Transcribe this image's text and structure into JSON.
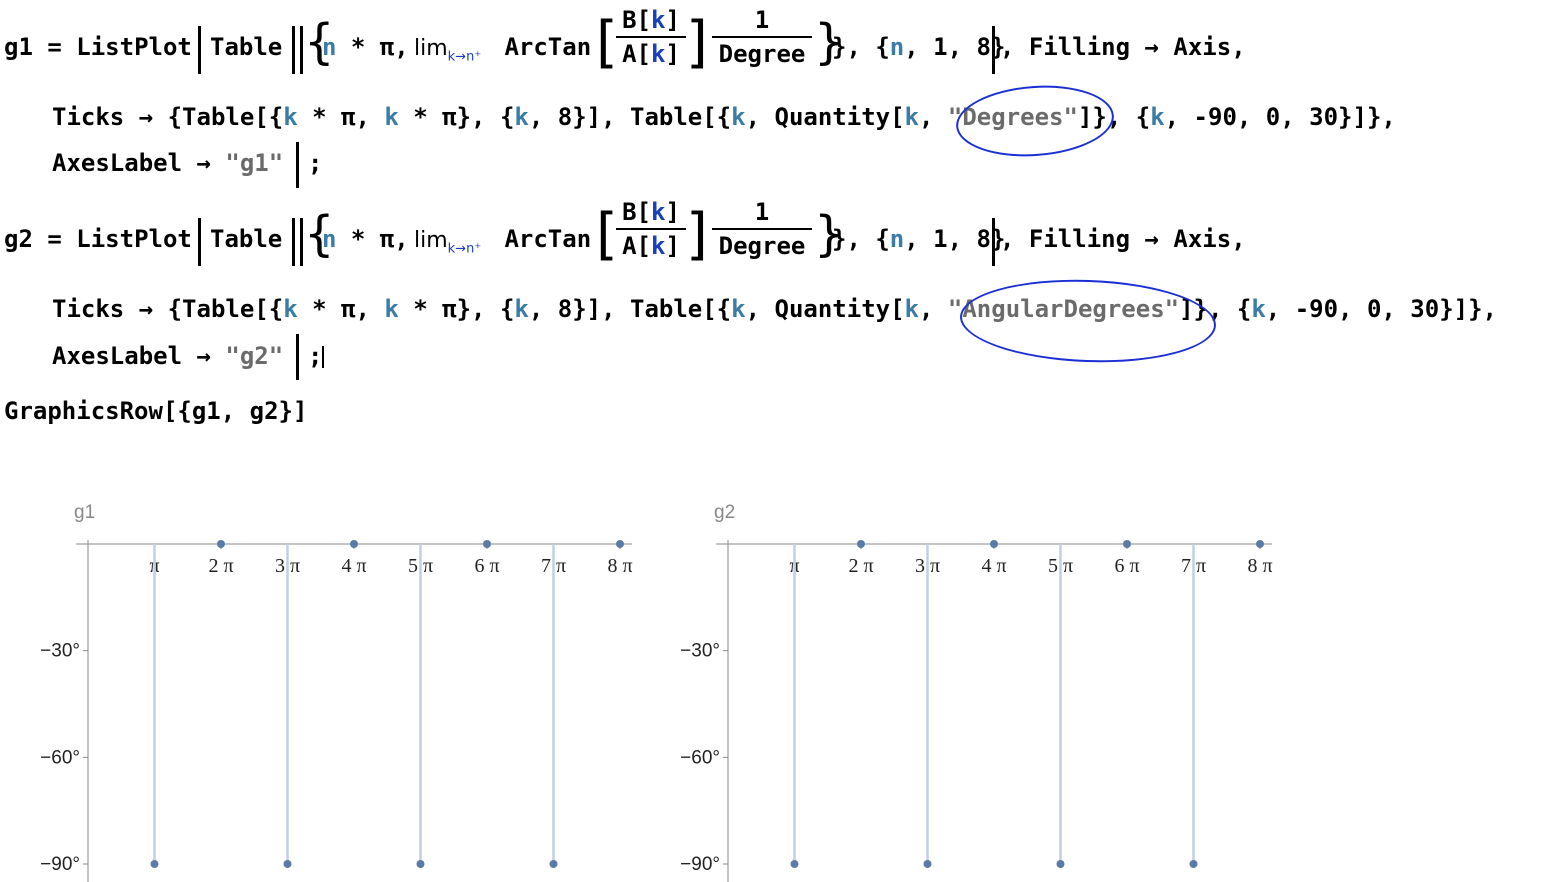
{
  "code": {
    "g1_assign": "g1",
    "g2_assign": "g2",
    "eq": " = ",
    "listplot": "ListPlot",
    "table": "Table",
    "n_pi": "n",
    "star_pi": " * π, ",
    "lim": "lim",
    "lim_sub": "k→n⁺",
    "arctan": " ArcTan",
    "frac_B": "B[",
    "frac_A": "A[",
    "k": "k",
    "close_br": "]",
    "one": "1",
    "degree": "Degree",
    "range_open": "}, {",
    "range_n": "n",
    "range_rest": ", 1, 8}",
    "filling": ", Filling → Axis,",
    "ticks_line_1": "Ticks → {Table[{",
    "ticks_k1": "k",
    "ticks_mid1": " * π, ",
    "ticks_k2": "k",
    "ticks_mid2": " * π}, {",
    "ticks_k3": "k",
    "ticks_mid3": ", 8}], Table[{",
    "ticks_k4": "k",
    "ticks_mid4": ", Quantity[",
    "ticks_k5": "k",
    "ticks_comma": ", ",
    "g1_unit": "\"Degrees\"",
    "g2_unit": "\"AngularDegrees\"",
    "ticks_tail_a": "]}, {",
    "ticks_k6": "k",
    "ticks_tail_b": ", -90, 0, 30}]},",
    "axeslabel": "AxesLabel → ",
    "g1_label_str": "\"g1\"",
    "g2_label_str": "\"g2\"",
    "semicolon": ";",
    "graphicsrow": "GraphicsRow[{g1, g2}]"
  },
  "plots": [
    {
      "label": "g1"
    },
    {
      "label": "g2"
    }
  ],
  "annotation_color": "#1a2fd4",
  "chart_data": [
    {
      "type": "scatter",
      "title": "",
      "ylabel": "g1",
      "xlabel": "",
      "filling": "axis",
      "x_ticks": [
        "π",
        "2 π",
        "3 π",
        "4 π",
        "5 π",
        "6 π",
        "7 π",
        "8 π"
      ],
      "y_ticks": [
        "−90°",
        "−60°",
        "−30°"
      ],
      "ylim": [
        -90,
        0
      ],
      "xlim_multiples_of_pi": [
        0,
        8
      ],
      "points": [
        {
          "x": "π",
          "y": -90
        },
        {
          "x": "2 π",
          "y": 0
        },
        {
          "x": "3 π",
          "y": -90
        },
        {
          "x": "4 π",
          "y": 0
        },
        {
          "x": "5 π",
          "y": -90
        },
        {
          "x": "6 π",
          "y": 0
        },
        {
          "x": "7 π",
          "y": -90
        },
        {
          "x": "8 π",
          "y": 0
        }
      ],
      "color": "#5b7ba6"
    },
    {
      "type": "scatter",
      "title": "",
      "ylabel": "g2",
      "xlabel": "",
      "filling": "axis",
      "x_ticks": [
        "π",
        "2 π",
        "3 π",
        "4 π",
        "5 π",
        "6 π",
        "7 π",
        "8 π"
      ],
      "y_ticks": [
        "−90°",
        "−60°",
        "−30°"
      ],
      "ylim": [
        -90,
        0
      ],
      "xlim_multiples_of_pi": [
        0,
        8
      ],
      "points": [
        {
          "x": "π",
          "y": -90
        },
        {
          "x": "2 π",
          "y": 0
        },
        {
          "x": "3 π",
          "y": -90
        },
        {
          "x": "4 π",
          "y": 0
        },
        {
          "x": "5 π",
          "y": -90
        },
        {
          "x": "6 π",
          "y": 0
        },
        {
          "x": "7 π",
          "y": -90
        },
        {
          "x": "8 π",
          "y": 0
        }
      ],
      "color": "#5b7ba6"
    }
  ]
}
